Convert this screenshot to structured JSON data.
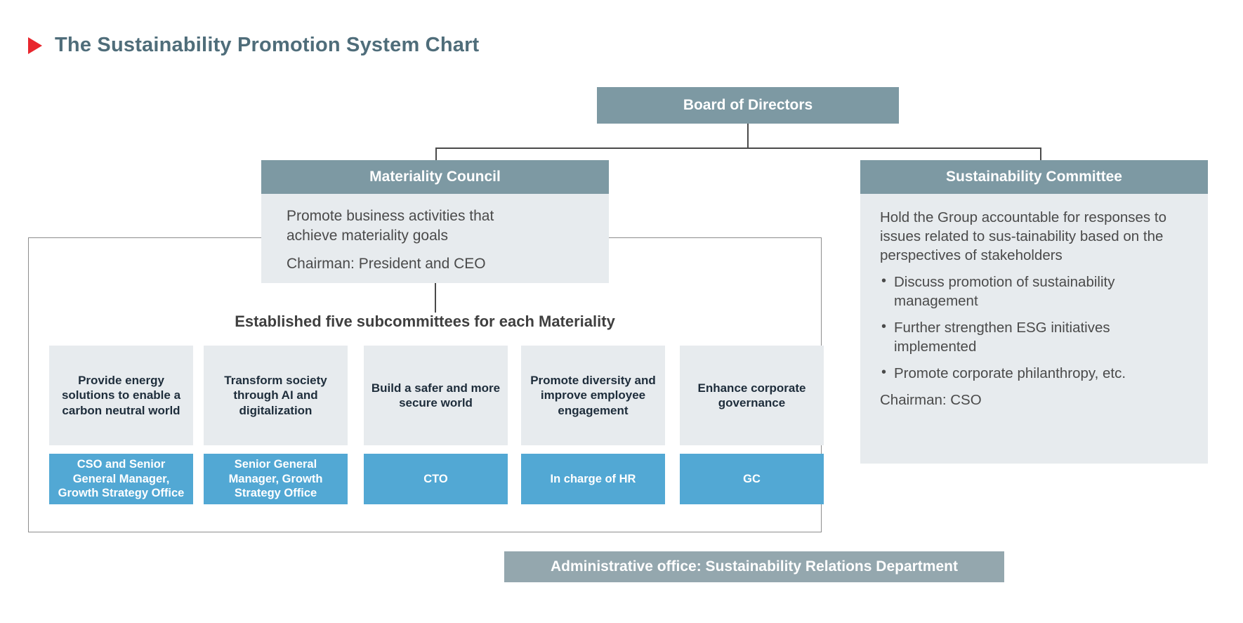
{
  "page": {
    "title": "The Sustainability Promotion System Chart",
    "title_marker_icon": "triangle-right-icon",
    "colors": {
      "accent_red": "#e8262d",
      "header_slate": "#7d99a3",
      "panel_grey": "#e7ebee",
      "role_blue": "#52a8d4",
      "admin_bar": "#94a7ae",
      "title_text": "#4f6d7a"
    }
  },
  "board": {
    "label": "Board of Directors"
  },
  "materiality_council": {
    "header": "Materiality Council",
    "line1": "Promote business activities that",
    "line2": "achieve materiality goals",
    "chairman": "Chairman: President and CEO"
  },
  "sustainability_committee": {
    "header": "Sustainability Committee",
    "paragraph": "Hold the Group accountable for responses to issues related to sus-tainability based on the perspectives of stakeholders",
    "bullets": [
      "Discuss promotion of sustainability management",
      "Further strengthen ESG initiatives implemented",
      "Promote corporate philanthropy, etc."
    ],
    "chairman": "Chairman: CSO"
  },
  "subcommittees": {
    "caption": "Established five subcommittees for each Materiality",
    "items": [
      {
        "topic": "Provide energy solutions to enable a carbon neutral world",
        "role": "CSO and Senior General Manager, Growth Strategy Office"
      },
      {
        "topic": "Transform society through AI and digitalization",
        "role": "Senior General Manager, Growth Strategy Office"
      },
      {
        "topic": "Build a safer and more secure world",
        "role": "CTO"
      },
      {
        "topic": "Promote diversity and improve employee engagement",
        "role": "In charge of HR"
      },
      {
        "topic": "Enhance corporate governance",
        "role": "GC"
      }
    ]
  },
  "administrative_office": {
    "label": "Administrative office: Sustainability Relations Department"
  }
}
